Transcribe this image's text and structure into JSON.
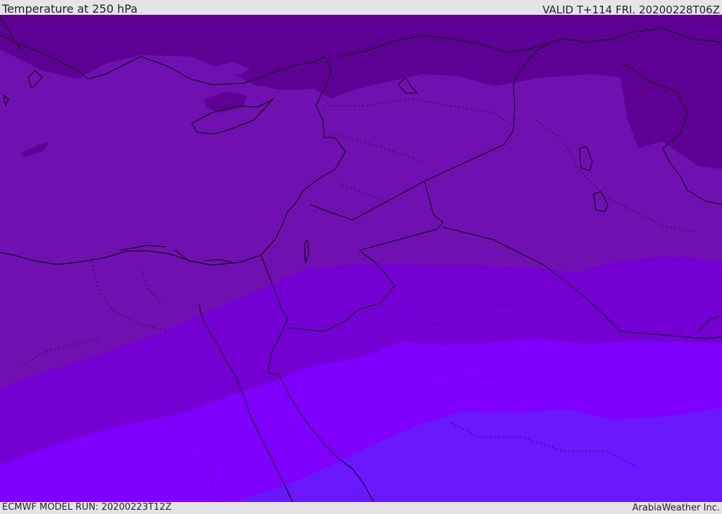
{
  "header": {
    "title": "Temperature at 250 hPa",
    "valid_time": "VALID T+114 FRI. 20200228T06Z"
  },
  "footer": {
    "model_run": "ECMWF MODEL RUN: 20200223T12Z",
    "credit": "ArabiaWeather Inc."
  },
  "map": {
    "field": "temperature",
    "pressure_level": "250 hPa",
    "colors": {
      "band_darkest": "#5e0094",
      "band_dark": "#7010b0",
      "band_mid": "#7400d4",
      "band_bright": "#7f00ff",
      "band_blue": "#6a18ff",
      "border_color": "#000000"
    }
  }
}
